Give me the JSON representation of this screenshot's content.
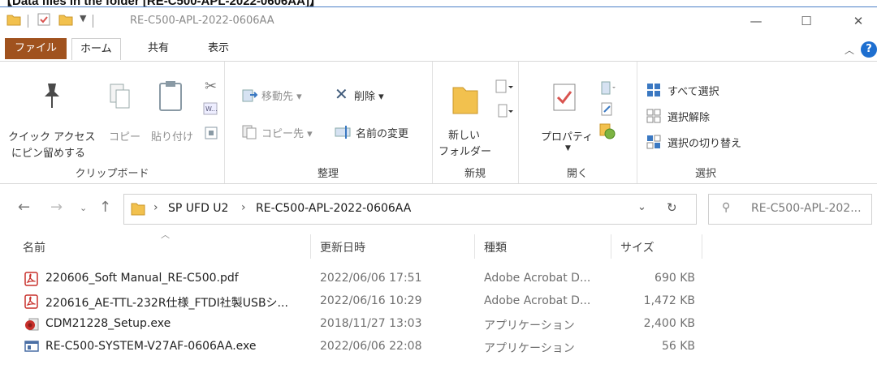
{
  "caption": "【Data files in the folder [RE-C500-APL-2022-0606AA]】",
  "window": {
    "title": "RE-C500-APL-2022-0606AA",
    "controls": {
      "minimize": "—",
      "maximize": "☐",
      "close": "✕"
    }
  },
  "tabs": {
    "file": "ファイル",
    "home": "ホーム",
    "share": "共有",
    "view": "表示",
    "help": "?"
  },
  "ribbon": {
    "clipboard": {
      "pin_line1": "クイック アクセス",
      "pin_line2": "にピン留めする",
      "copy": "コピー",
      "paste": "貼り付け",
      "label": "クリップボード"
    },
    "organize": {
      "move_to": "移動先 ▾",
      "delete": "削除 ▾",
      "copy_to": "コピー先 ▾",
      "rename": "名前の変更",
      "label": "整理"
    },
    "new": {
      "folder_line1": "新しい",
      "folder_line2": "フォルダー",
      "label": "新規"
    },
    "open": {
      "properties": "プロパティ",
      "label": "開く"
    },
    "select": {
      "all": "すべて選択",
      "none": "選択解除",
      "invert": "選択の切り替え",
      "label": "選択"
    }
  },
  "address": {
    "crumbs": [
      "SP UFD U2",
      "RE-C500-APL-2022-0606AA"
    ],
    "search_placeholder": "RE-C500-APL-202..."
  },
  "columns": [
    "名前",
    "更新日時",
    "種類",
    "サイズ"
  ],
  "files": [
    {
      "name": "220606_Soft Manual_RE-C500.pdf",
      "date": "2022/06/06 17:51",
      "type": "Adobe Acrobat D...",
      "size": "690 KB",
      "icon": "pdf-icon"
    },
    {
      "name": "220616_AE-TTL-232R仕様_FTDI社製USBシ...",
      "date": "2022/06/16 10:29",
      "type": "Adobe Acrobat D...",
      "size": "1,472 KB",
      "icon": "pdf-icon"
    },
    {
      "name": "CDM21228_Setup.exe",
      "date": "2018/11/27 13:03",
      "type": "アプリケーション",
      "size": "2,400 KB",
      "icon": "setup-icon"
    },
    {
      "name": "RE-C500-SYSTEM-V27AF-0606AA.exe",
      "date": "2022/06/06 22:08",
      "type": "アプリケーション",
      "size": "56 KB",
      "icon": "exe-icon"
    }
  ],
  "colors": {
    "file_tab": "#a0521e",
    "folder": "#f2c14e",
    "pdf": "#c8302b",
    "accent": "#1e6fd0"
  }
}
